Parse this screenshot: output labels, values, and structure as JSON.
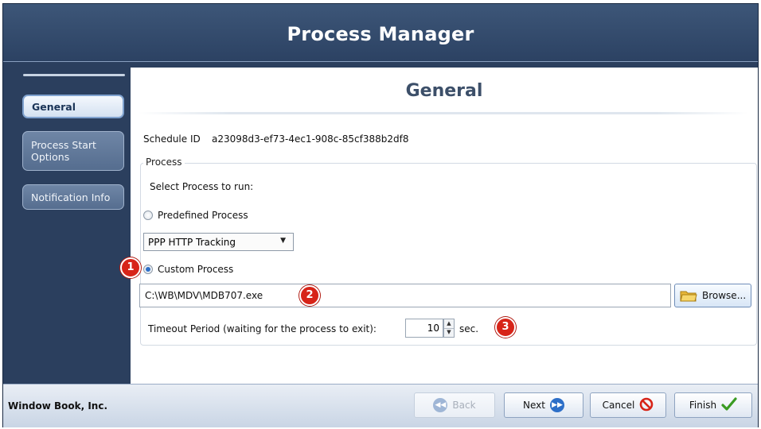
{
  "window": {
    "title": "Process Manager"
  },
  "sidebar": {
    "items": [
      {
        "label": "General",
        "selected": true
      },
      {
        "label": "Process Start Options",
        "selected": false
      },
      {
        "label": "Notification Info",
        "selected": false
      }
    ]
  },
  "main": {
    "section_title": "General",
    "schedule_id_label": "Schedule ID",
    "schedule_id_value": "a23098d3-ef73-4ec1-908c-85cf388b2df8",
    "process_group_label": "Process",
    "select_process_label": "Select Process to run:",
    "predefined_label": "Predefined Process",
    "predefined_selected": false,
    "predefined_dropdown_value": "PPP HTTP Tracking",
    "custom_label": "Custom Process",
    "custom_selected": true,
    "custom_path": "C:\\WB\\MDV\\MDB707.exe",
    "browse_label": "Browse...",
    "timeout_label": "Timeout Period (waiting for the process to exit):",
    "timeout_value": "10",
    "timeout_unit": "sec.",
    "callouts": [
      "1",
      "2",
      "3"
    ]
  },
  "footer": {
    "company": "Window Book, Inc.",
    "back_label": "Back",
    "next_label": "Next",
    "cancel_label": "Cancel",
    "finish_label": "Finish"
  },
  "colors": {
    "window_bg": "#2b3f5e",
    "accent_blue": "#2d6fc8",
    "callout_red": "#d72418",
    "finish_green": "#3a9b22"
  }
}
